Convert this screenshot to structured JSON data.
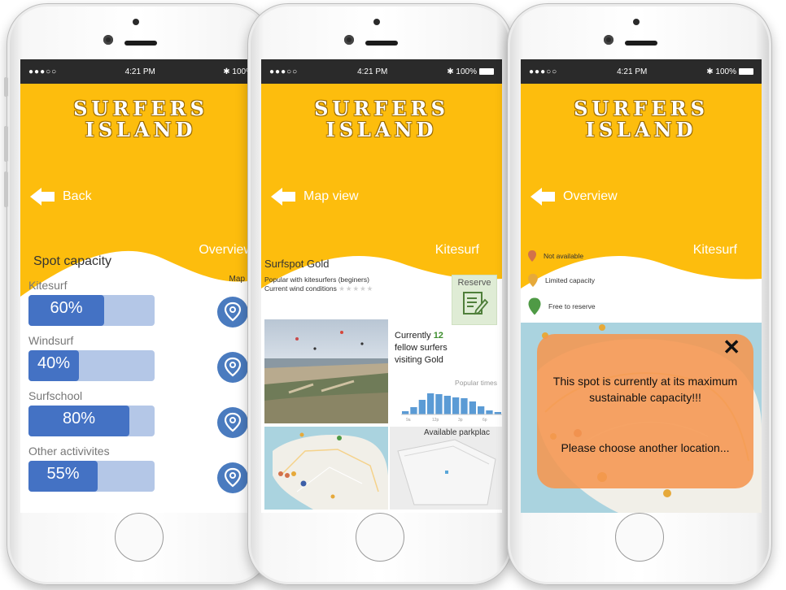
{
  "status": {
    "signal": "●●●○○",
    "time": "4:21 PM",
    "battery": "100%"
  },
  "logo": {
    "line1": "SURFERS",
    "line2": "ISLAND"
  },
  "colors": {
    "header": "#fdbd0d",
    "bar_fill": "#4472c4",
    "bar_bg": "#b4c7e7",
    "popup": "#f59650"
  },
  "screen1": {
    "back_label": "Back",
    "tab_label": "Overview",
    "title": "Spot capacity",
    "map_header": "Map",
    "activities": [
      {
        "name": "Kitesurf",
        "value": "60%",
        "fraction": 0.6,
        "icon": "map-pin-icon"
      },
      {
        "name": "Windsurf",
        "value": "40%",
        "fraction": 0.4,
        "icon": "map-pin-icon"
      },
      {
        "name": "Surfschool",
        "value": "80%",
        "fraction": 0.8,
        "icon": "map-pin-icon"
      },
      {
        "name": "Other activivites",
        "value": "55%",
        "fraction": 0.55,
        "icon": "map-pin-icon"
      }
    ]
  },
  "screen2": {
    "back_label": "Map view",
    "tab_label": "Kitesurf",
    "spot_title": "Surfspot Gold",
    "desc_line1": "Popular with kitesurfers (beginers)",
    "desc_line2": "Current wind conditions",
    "stars": "★★★★★",
    "reserve_label": "Reserve",
    "visit_line1": "Currently",
    "visit_count": "12",
    "visit_line2": "fellow surfers",
    "visit_line3": "visiting Gold",
    "popular_label": "Popular times",
    "popular_bars": [
      0.15,
      0.35,
      0.7,
      1.0,
      0.95,
      0.9,
      0.8,
      0.75,
      0.6,
      0.4,
      0.2,
      0.1
    ],
    "popular_ticks": [
      "9a",
      "12p",
      "3p",
      "6p"
    ],
    "parking_label": "Available parkplac"
  },
  "screen3": {
    "back_label": "Overview",
    "tab_label": "Kitesurf",
    "legend": [
      {
        "label": "Not available",
        "color": "#d2714a"
      },
      {
        "label": "Limited capacity",
        "color": "#e6a93a"
      },
      {
        "label": "Free to reserve",
        "color": "#4f9a45"
      }
    ],
    "close_symbol": "✕",
    "popup_msg1": "This spot is currently at its maximum sustainable capacity!!!",
    "popup_msg2": "Please choose another location..."
  }
}
